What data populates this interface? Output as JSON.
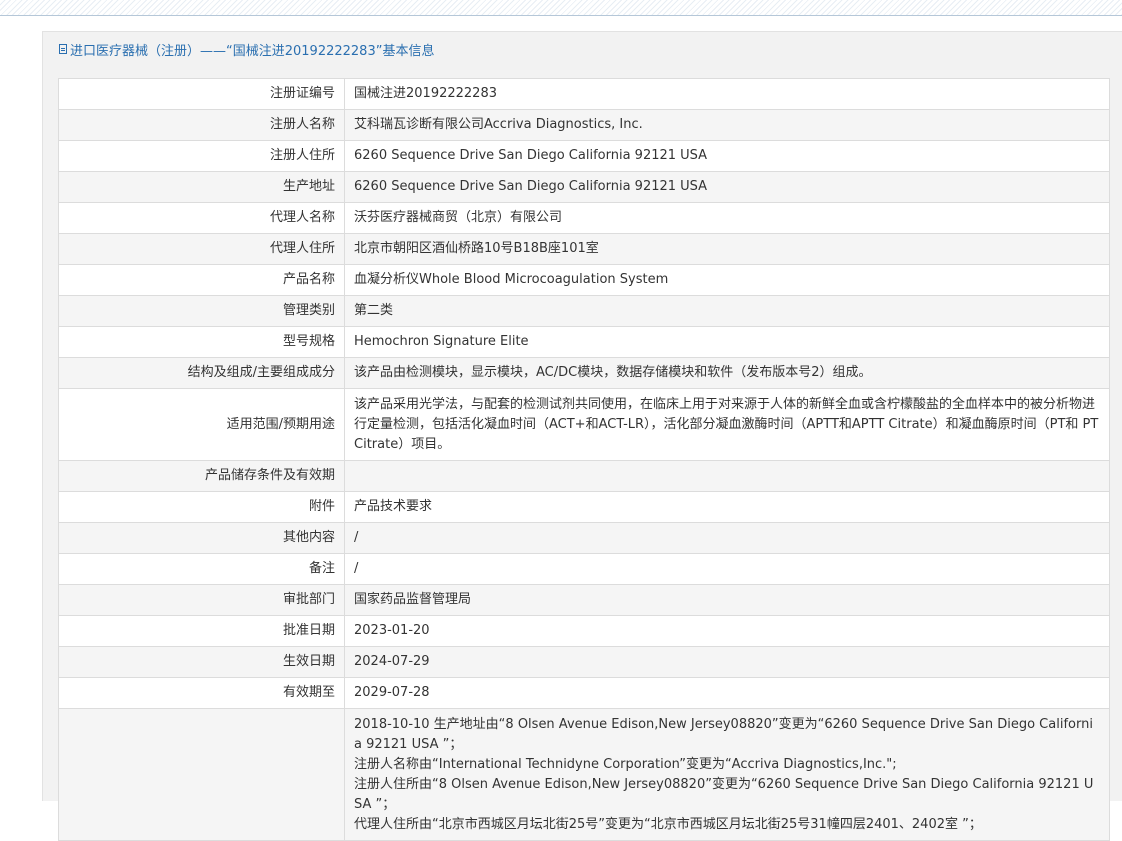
{
  "header": {
    "title": "进口医疗器械（注册）——“国械注进20192222283”基本信息"
  },
  "rows": [
    {
      "label": "注册证编号",
      "value": "国械注进20192222283"
    },
    {
      "label": "注册人名称",
      "value": "艾科瑞瓦诊断有限公司Accriva Diagnostics, Inc."
    },
    {
      "label": "注册人住所",
      "value": "6260 Sequence Drive San Diego California 92121 USA"
    },
    {
      "label": "生产地址",
      "value": "6260 Sequence Drive San Diego California 92121 USA"
    },
    {
      "label": "代理人名称",
      "value": "沃芬医疗器械商贸（北京）有限公司"
    },
    {
      "label": "代理人住所",
      "value": "北京市朝阳区酒仙桥路10号B18B座101室"
    },
    {
      "label": "产品名称",
      "value": "血凝分析仪Whole Blood Microcoagulation System"
    },
    {
      "label": "管理类别",
      "value": "第二类"
    },
    {
      "label": "型号规格",
      "value": "Hemochron Signature Elite"
    },
    {
      "label": "结构及组成/主要组成成分",
      "value": "该产品由检测模块，显示模块，AC/DC模块，数据存储模块和软件（发布版本号2）组成。"
    },
    {
      "label": "适用范围/预期用途",
      "value": "该产品采用光学法，与配套的检测试剂共同使用，在临床上用于对来源于人体的新鲜全血或含柠檬酸盐的全血样本中的被分析物进行定量检测，包括活化凝血时间（ACT+和ACT-LR），活化部分凝血激酶时间（APTT和APTT Citrate）和凝血酶原时间（PT和 PT Citrate）项目。"
    },
    {
      "label": "产品储存条件及有效期",
      "value": ""
    },
    {
      "label": "附件",
      "value": "产品技术要求"
    },
    {
      "label": "其他内容",
      "value": "/"
    },
    {
      "label": "备注",
      "value": "/"
    },
    {
      "label": "审批部门",
      "value": "国家药品监督管理局"
    },
    {
      "label": "批准日期",
      "value": "2023-01-20"
    },
    {
      "label": "生效日期",
      "value": "2024-07-29"
    },
    {
      "label": "有效期至",
      "value": "2029-07-28"
    }
  ],
  "changes": {
    "label": "",
    "lines": [
      "2018-10-10 生产地址由“8 Olsen Avenue Edison,New Jersey08820”变更为“6260 Sequence Drive San Diego California 92121 USA ”；",
      "注册人名称由“International Technidyne Corporation”变更为“Accriva Diagnostics,Inc.\";",
      "注册人住所由“8 Olsen Avenue Edison,New Jersey08820”变更为“6260 Sequence Drive San Diego California 92121 USA ”；",
      "代理人住所由“北京市西城区月坛北街25号”变更为“北京市西城区月坛北街25号31幢四层2401、2402室 ”；"
    ]
  }
}
